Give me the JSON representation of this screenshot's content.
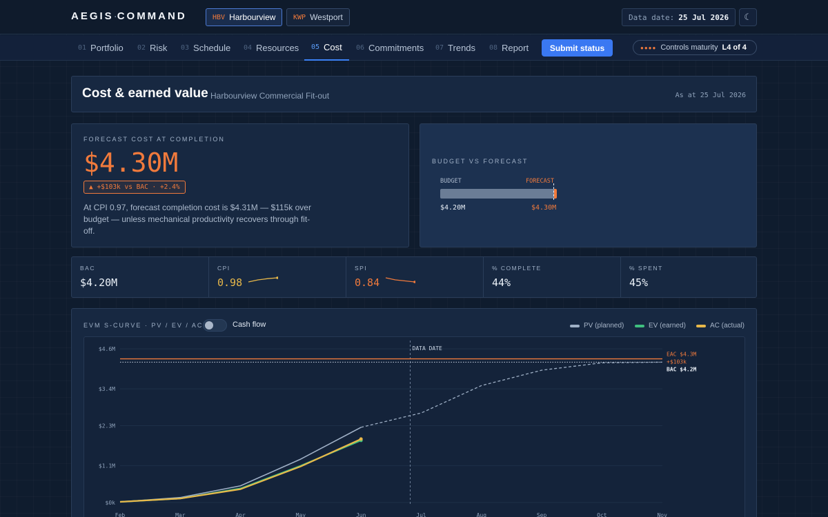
{
  "brand": {
    "name_left": "AEGIS",
    "dot": "·",
    "name_right": "COMMAND"
  },
  "projects": [
    {
      "code": "HBV",
      "name": "Harbourview",
      "active": true
    },
    {
      "code": "KWP",
      "name": "Westport",
      "active": false
    }
  ],
  "data_date": {
    "label": "Data date:",
    "value": "25 Jul 2026"
  },
  "theme_icon": "☾",
  "nav": {
    "tabs": [
      {
        "num": "01",
        "label": "Portfolio"
      },
      {
        "num": "02",
        "label": "Risk"
      },
      {
        "num": "03",
        "label": "Schedule"
      },
      {
        "num": "04",
        "label": "Resources"
      },
      {
        "num": "05",
        "label": "Cost",
        "active": true
      },
      {
        "num": "06",
        "label": "Commitments"
      },
      {
        "num": "07",
        "label": "Trends"
      },
      {
        "num": "08",
        "label": "Report"
      }
    ],
    "submit_label": "Submit status",
    "maturity": {
      "dots": "●●●●",
      "label": "Controls maturity",
      "level": "L4 of 4"
    }
  },
  "header": {
    "title": "Cost & earned value",
    "subtitle": "Harbourview Commercial Fit-out",
    "as_at": "As at 25 Jul 2026"
  },
  "forecast": {
    "label": "FORECAST COST AT COMPLETION",
    "value": "$4.30M",
    "variance": "▲ +$103k vs BAC · +2.4%",
    "description": "At CPI 0.97, forecast completion cost is $4.31M — $115k over budget — unless mechanical productivity recovers through fit-off."
  },
  "budget_vs_forecast": {
    "label": "BUDGET VS FORECAST",
    "budget_label": "BUDGET",
    "forecast_label": "FORECAST",
    "budget_value": "$4.20M",
    "forecast_value": "$4.30M",
    "budget_amount": 4.2,
    "forecast_amount": 4.3
  },
  "kpis": [
    {
      "label": "BAC",
      "value": "$4.20M"
    },
    {
      "label": "CPI",
      "value": "0.98",
      "color": "#e8b84a",
      "trend": [
        0.97,
        0.975,
        0.978,
        0.98
      ]
    },
    {
      "label": "SPI",
      "value": "0.84",
      "color": "#f07a3c",
      "trend": [
        0.88,
        0.86,
        0.85,
        0.84
      ]
    },
    {
      "label": "% COMPLETE",
      "value": "44%"
    },
    {
      "label": "% SPENT",
      "value": "45%"
    }
  ],
  "evm": {
    "label": "EVM S-CURVE · PV / EV / AC",
    "toggle_label": "Cash flow",
    "legend": [
      {
        "name": "PV (planned)",
        "color": "#9fb0c6"
      },
      {
        "name": "EV (earned)",
        "color": "#3fbf7f"
      },
      {
        "name": "AC (actual)",
        "color": "#e8b84a"
      }
    ]
  },
  "chart_data": {
    "type": "line",
    "x": [
      "Feb",
      "Mar",
      "Apr",
      "May",
      "Jun",
      "Jul",
      "Aug",
      "Sep",
      "Oct",
      "Nov"
    ],
    "ylim": [
      0,
      4.6
    ],
    "y_ticks": [
      "$0k",
      "$1.1M",
      "$2.3M",
      "$3.4M",
      "$4.6M"
    ],
    "y_tick_values": [
      0,
      1.1,
      2.3,
      3.4,
      4.6
    ],
    "data_date_label": "DATA DATE",
    "data_date_x": 5,
    "series": [
      {
        "name": "PV (planned)",
        "color": "#9fb0c6",
        "values": [
          0.02,
          0.15,
          0.5,
          1.3,
          2.25
        ],
        "forecast_values": [
          2.25,
          2.68,
          3.5,
          3.96,
          4.18,
          4.2
        ]
      },
      {
        "name": "EV (earned)",
        "color": "#3fbf7f",
        "values": [
          0.02,
          0.12,
          0.42,
          1.1,
          1.86
        ]
      },
      {
        "name": "AC (actual)",
        "color": "#e8b84a",
        "values": [
          0.02,
          0.12,
          0.4,
          1.08,
          1.9
        ]
      }
    ],
    "reference_lines": [
      {
        "label": "EAC $4.3M",
        "sub_label": "+$103k",
        "value": 4.3,
        "color": "#f07a3c"
      },
      {
        "label": "BAC $4.2M",
        "value": 4.2,
        "color": "#c9d4e3"
      }
    ]
  }
}
